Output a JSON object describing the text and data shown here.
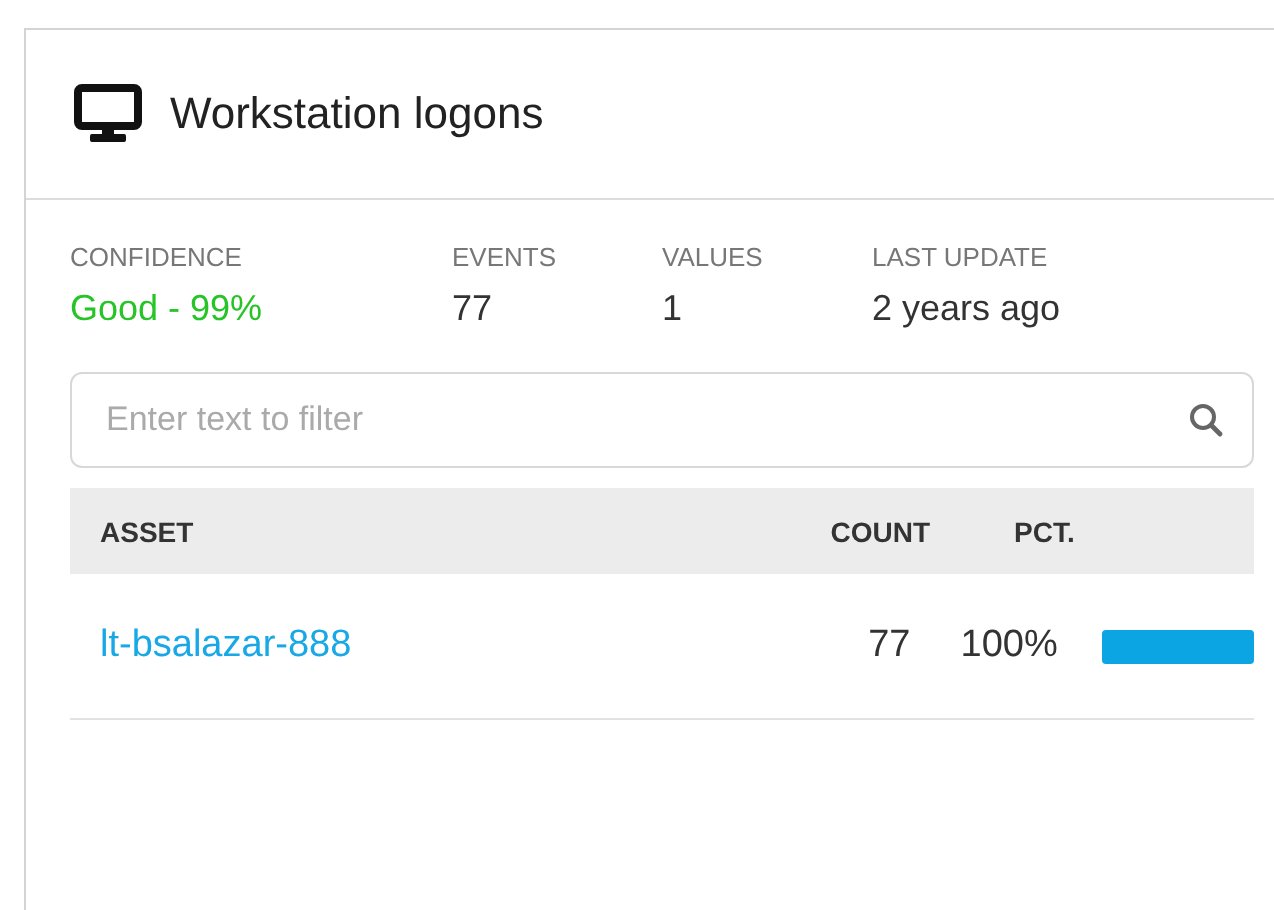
{
  "panel": {
    "title": "Workstation logons"
  },
  "stats": [
    {
      "label": "CONFIDENCE",
      "value": "Good - 99%",
      "kind": "good"
    },
    {
      "label": "EVENTS",
      "value": "77",
      "kind": "plain"
    },
    {
      "label": "VALUES",
      "value": "1",
      "kind": "plain"
    },
    {
      "label": "LAST UPDATE",
      "value": "2 years ago",
      "kind": "plain"
    }
  ],
  "filter": {
    "placeholder": "Enter text to filter"
  },
  "table": {
    "columns": [
      "ASSET",
      "COUNT",
      "PCT."
    ],
    "rows": [
      {
        "asset": "lt-bsalazar-888",
        "count": "77",
        "pct": "100%",
        "level": 1
      }
    ]
  }
}
